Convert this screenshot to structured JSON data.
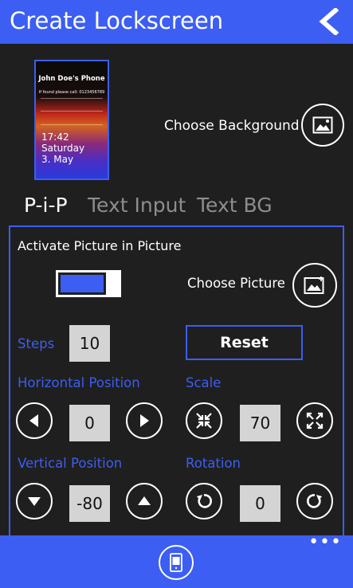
{
  "header": {
    "title": "Create Lockscreen",
    "back_icon": "back-arrow-icon"
  },
  "preview": {
    "phone_name": "John Doe's Phone",
    "found_text": "If found please call: 0123456789",
    "time": "17:42",
    "day": "Saturday",
    "date": "3. May"
  },
  "background": {
    "label": "Choose Background",
    "icon": "image-icon"
  },
  "tabs": [
    {
      "label": "P-i-P",
      "active": true
    },
    {
      "label": "Text Input",
      "active": false
    },
    {
      "label": "Text BG",
      "active": false
    }
  ],
  "pip": {
    "activate_label": "Activate Picture in Picture",
    "activated": true,
    "choose_picture_label": "Choose Picture",
    "steps_label": "Steps",
    "steps_value": "10",
    "reset_label": "Reset",
    "horizontal_label": "Horizontal Position",
    "horizontal_value": "0",
    "scale_label": "Scale",
    "scale_value": "70",
    "vertical_label": "Vertical Position",
    "vertical_value": "-80",
    "rotation_label": "Rotation",
    "rotation_value": "0"
  },
  "appbar": {
    "more": "•••",
    "icon": "phone-preview-icon"
  },
  "colors": {
    "accent": "#3c5ef2",
    "background": "#1f1f1f",
    "value_box": "#d4d4d4"
  }
}
